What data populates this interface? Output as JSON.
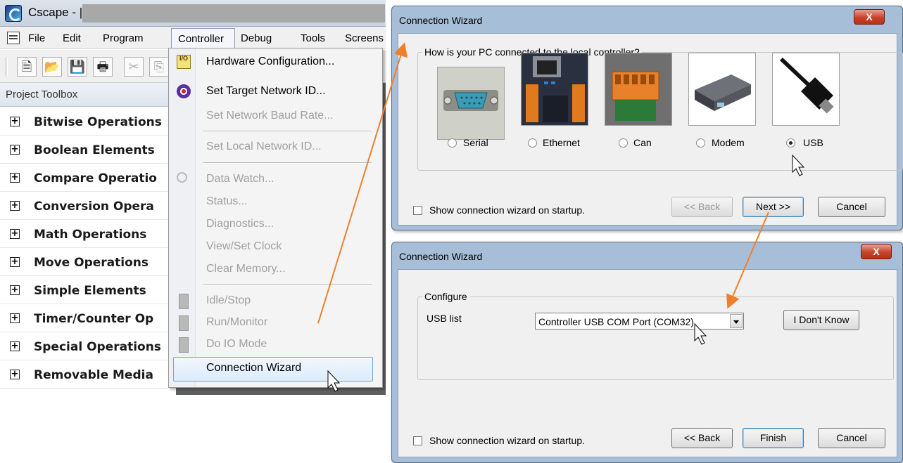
{
  "app": {
    "title": "Cscape - |",
    "menu": [
      "File",
      "Edit",
      "Program",
      "Controller",
      "Debug",
      "Tools",
      "Screens"
    ],
    "toolbox_title": "Project Toolbox",
    "toolbox_items": [
      "Bitwise Operations",
      "Boolean Elements",
      "Compare Operatio",
      "Conversion Opera",
      "Math Operations",
      "Move Operations",
      "Simple Elements",
      "Timer/Counter Op",
      "Special Operations",
      "Removable Media"
    ]
  },
  "controller_menu": {
    "items": [
      {
        "label": "Hardware Configuration...",
        "enabled": true,
        "icon": "io-config-icon"
      },
      {
        "label": "Set Target Network ID...",
        "enabled": true,
        "icon": "target-icon"
      },
      {
        "label": "Set Network Baud Rate...",
        "enabled": false
      },
      {
        "label": "Set Local Network ID...",
        "enabled": false
      },
      {
        "label": "Data Watch...",
        "enabled": false,
        "icon": "magnifier-icon"
      },
      {
        "label": "Status...",
        "enabled": false
      },
      {
        "label": "Diagnostics...",
        "enabled": false
      },
      {
        "label": "View/Set Clock",
        "enabled": false
      },
      {
        "label": "Clear Memory...",
        "enabled": false
      },
      {
        "label": "Idle/Stop",
        "enabled": false,
        "icon": "idle-icon"
      },
      {
        "label": "Run/Monitor",
        "enabled": false,
        "icon": "run-icon"
      },
      {
        "label": "Do IO Mode",
        "enabled": false,
        "icon": "io-mode-icon"
      },
      {
        "label": "Connection Wizard",
        "enabled": true,
        "highlighted": true
      }
    ]
  },
  "wizard1": {
    "title": "Connection Wizard",
    "close": "X",
    "group_label": "How is your PC connected to the local controller?",
    "options": [
      {
        "label": "Serial",
        "selected": false
      },
      {
        "label": "Ethernet",
        "selected": false
      },
      {
        "label": "Can",
        "selected": false
      },
      {
        "label": "Modem",
        "selected": false
      },
      {
        "label": "USB",
        "selected": true
      }
    ],
    "startup_checkbox": "Show connection wizard on startup.",
    "back": "<< Back",
    "next": "Next >>",
    "cancel": "Cancel"
  },
  "wizard2": {
    "title": "Connection Wizard",
    "close": "X",
    "group_label": "Configure",
    "usb_label": "USB list",
    "usb_value": "Controller USB COM Port (COM32)",
    "dont_know": "I Don't Know",
    "startup_checkbox": "Show connection wizard on startup.",
    "back": "<< Back",
    "finish": "Finish",
    "cancel": "Cancel"
  },
  "colors": {
    "arrow": "#f07f2c",
    "dialog_frame": "#a6bed8"
  }
}
